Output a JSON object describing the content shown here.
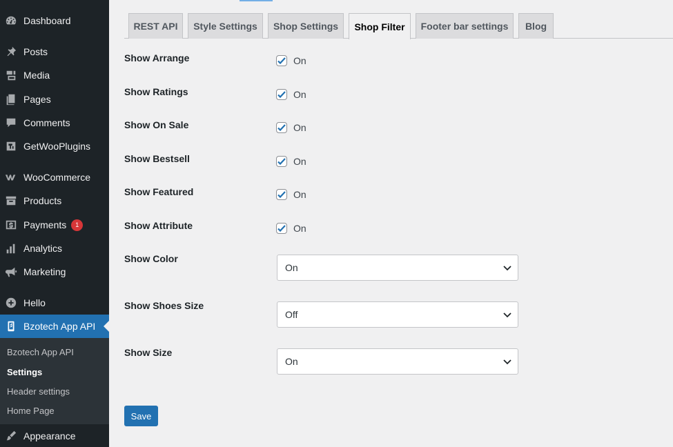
{
  "sidebar": {
    "items": [
      {
        "label": "Dashboard",
        "icon": "dashboard-icon"
      },
      {
        "label": "Posts",
        "icon": "pin-icon"
      },
      {
        "label": "Media",
        "icon": "media-icon"
      },
      {
        "label": "Pages",
        "icon": "pages-icon"
      },
      {
        "label": "Comments",
        "icon": "comment-icon"
      },
      {
        "label": "GetWooPlugins",
        "icon": "plugin-icon"
      },
      {
        "label": "WooCommerce",
        "icon": "woo-icon"
      },
      {
        "label": "Products",
        "icon": "archive-icon"
      },
      {
        "label": "Payments",
        "icon": "dollar-icon",
        "badge": "1"
      },
      {
        "label": "Analytics",
        "icon": "bar-chart-icon"
      },
      {
        "label": "Marketing",
        "icon": "megaphone-icon"
      },
      {
        "label": "Hello",
        "icon": "plus-circle-icon"
      },
      {
        "label": "Bzotech App API",
        "icon": "phone-icon"
      },
      {
        "label": "Appearance",
        "icon": "brush-icon"
      }
    ],
    "submenu": [
      {
        "label": "Bzotech App API"
      },
      {
        "label": "Settings"
      },
      {
        "label": "Header settings"
      },
      {
        "label": "Home Page"
      }
    ]
  },
  "tabs": [
    {
      "label": "REST API"
    },
    {
      "label": "Style Settings"
    },
    {
      "label": "Shop Settings"
    },
    {
      "label": "Shop Filter"
    },
    {
      "label": "Footer bar settings"
    },
    {
      "label": "Blog"
    }
  ],
  "checkbox_rows": [
    {
      "label": "Show Arrange",
      "value": "On",
      "checked": true
    },
    {
      "label": "Show Ratings",
      "value": "On",
      "checked": true
    },
    {
      "label": "Show On Sale",
      "value": "On",
      "checked": true
    },
    {
      "label": "Show Bestsell",
      "value": "On",
      "checked": true
    },
    {
      "label": "Show Featured",
      "value": "On",
      "checked": true
    },
    {
      "label": "Show Attribute",
      "value": "On",
      "checked": true
    }
  ],
  "select_rows": [
    {
      "label": "Show Color",
      "value": "On"
    },
    {
      "label": "Show Shoes Size",
      "value": "Off"
    },
    {
      "label": "Show Size",
      "value": "On"
    }
  ],
  "save_label": "Save",
  "colors": {
    "sidebar": "#1d2327",
    "accent": "#2271b1",
    "badge": "#d63638"
  }
}
